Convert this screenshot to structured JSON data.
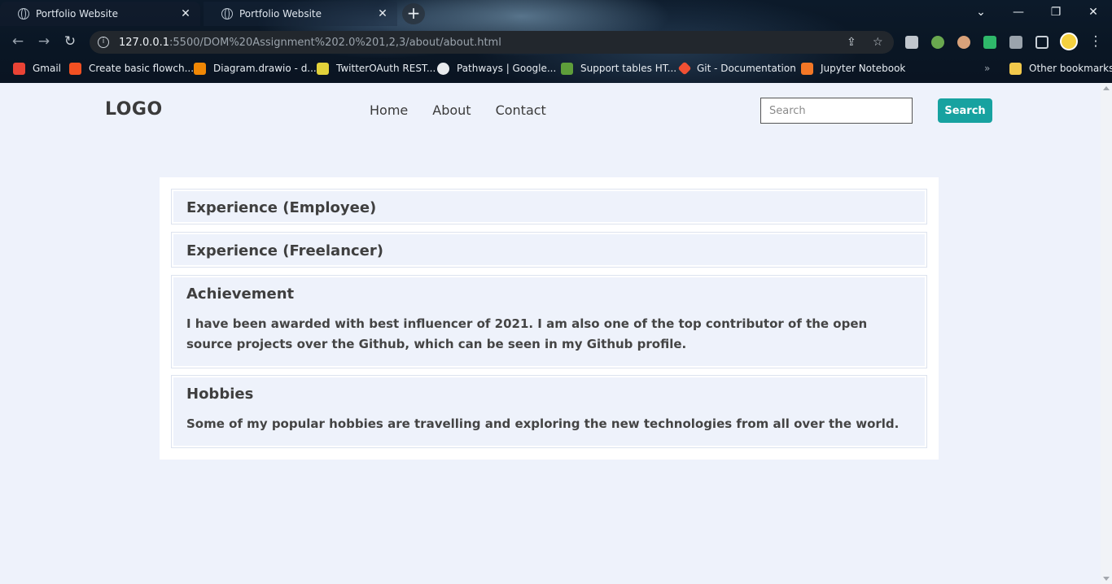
{
  "browser": {
    "tabs": [
      {
        "title": "Portfolio Website",
        "close": "✕"
      },
      {
        "title": "Portfolio Website",
        "close": "✕"
      }
    ],
    "new_tab": "+",
    "window_controls": {
      "minimize": "—",
      "restore": "❐",
      "close": "✕",
      "tab_search": "⌄"
    },
    "url_host": "127.0.0.1",
    "url_path": ":5500/DOM%20Assignment%202.0%201,2,3/about/about.html",
    "bookmarks": [
      {
        "label": "Gmail",
        "color": "#ea4335"
      },
      {
        "label": "Create basic flowch...",
        "color": "#f25022"
      },
      {
        "label": "Diagram.drawio - d...",
        "color": "#f08705"
      },
      {
        "label": "TwitterOAuth REST...",
        "color": "#e2d13a"
      },
      {
        "label": "Pathways | Google...",
        "color": "#e8eaed"
      },
      {
        "label": "Support tables HT...",
        "color": "#5e9e3a"
      },
      {
        "label": "Git - Documentation",
        "color": "#f05033"
      },
      {
        "label": "Jupyter Notebook",
        "color": "#f37726"
      }
    ],
    "overflow": "»",
    "other_bookmarks": "Other bookmarks"
  },
  "site": {
    "logo": "LOGO",
    "nav": [
      "Home",
      "About",
      "Contact"
    ],
    "search_placeholder": "Search",
    "search_button": "Search"
  },
  "sections": [
    {
      "title": "Experience (Employee)",
      "body": ""
    },
    {
      "title": "Experience (Freelancer)",
      "body": ""
    },
    {
      "title": "Achievement",
      "body": "I have been awarded with best influencer of 2021. I am also one of the top contributor of the open source projects over the Github, which can be seen in my Github profile."
    },
    {
      "title": "Hobbies",
      "body": "Some of my popular hobbies are travelling and exploring the new technologies from all over the world."
    }
  ]
}
